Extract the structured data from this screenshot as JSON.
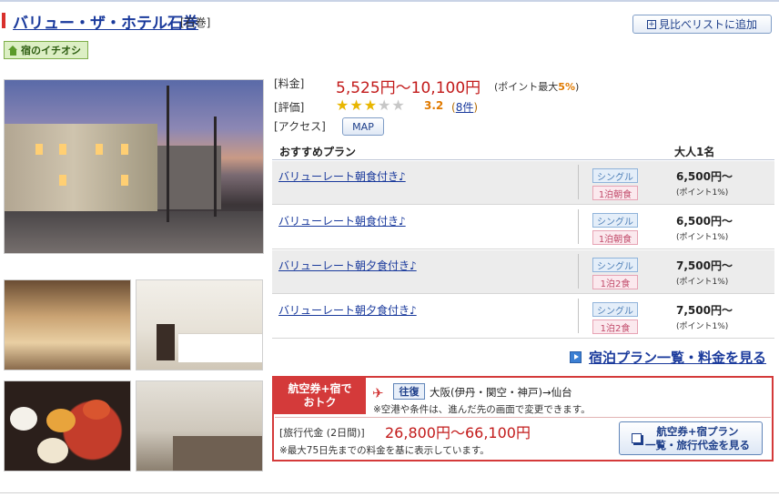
{
  "hotel": {
    "name": "バリュー・ザ・ホテル石巻",
    "area": "[石巻]",
    "compare_label": "見比べリストに追加",
    "badge": "宿のイチオシ"
  },
  "info": {
    "price_label": "[料金]",
    "price": "5,525円〜10,100円",
    "points_prefix": "(ポイント最大",
    "points_value": "5%",
    "points_suffix": ")",
    "rating_label": "[評価]",
    "stars_filled": 3,
    "stars_total": 5,
    "rating_value": "3.2",
    "review_open": "(",
    "review_count": "8件",
    "review_close": ")",
    "access_label": "[アクセス]",
    "map_label": "MAP"
  },
  "plans": {
    "col_plan": "おすすめプラン",
    "col_price": "大人1名",
    "rows": [
      {
        "name": "バリューレート朝食付き♪",
        "room": "シングル",
        "meal": "1泊朝食",
        "price": "6,500円〜",
        "points": "(ポイント1%)"
      },
      {
        "name": "バリューレート朝食付き♪",
        "room": "シングル",
        "meal": "1泊朝食",
        "price": "6,500円〜",
        "points": "(ポイント1%)"
      },
      {
        "name": "バリューレート朝夕食付き♪",
        "room": "シングル",
        "meal": "1泊2食",
        "price": "7,500円〜",
        "points": "(ポイント1%)"
      },
      {
        "name": "バリューレート朝夕食付き♪",
        "room": "シングル",
        "meal": "1泊2食",
        "price": "7,500円〜",
        "points": "(ポイント1%)"
      }
    ],
    "list_link": "宿泊プラン一覧・料金を見る"
  },
  "air": {
    "label_line1": "航空券+宿で",
    "label_line2": "おトク",
    "trip_type": "往復",
    "route": "大阪(伊丹・関空・神戸)→仙台",
    "note1": "※空港や条件は、進んだ先の画面で変更できます。",
    "fare_label": "[旅行代金 (2日間)]",
    "fare": "26,800円〜66,100円",
    "note2": "※最大75日先までの料金を基に表示しています。",
    "button_line1": "航空券+宿プラン",
    "button_line2": "一覧・旅行代金を見る"
  },
  "icons": {
    "compare": "plus-box-icon",
    "badge": "house-icon",
    "plane": "plane-icon",
    "list": "arrow-right-icon",
    "air_button": "windows-icon"
  },
  "colors": {
    "price_red": "#c21a1a",
    "link_blue": "#1a3a9c",
    "accent_red": "#d43a3a",
    "star_gold": "#e8b600"
  }
}
